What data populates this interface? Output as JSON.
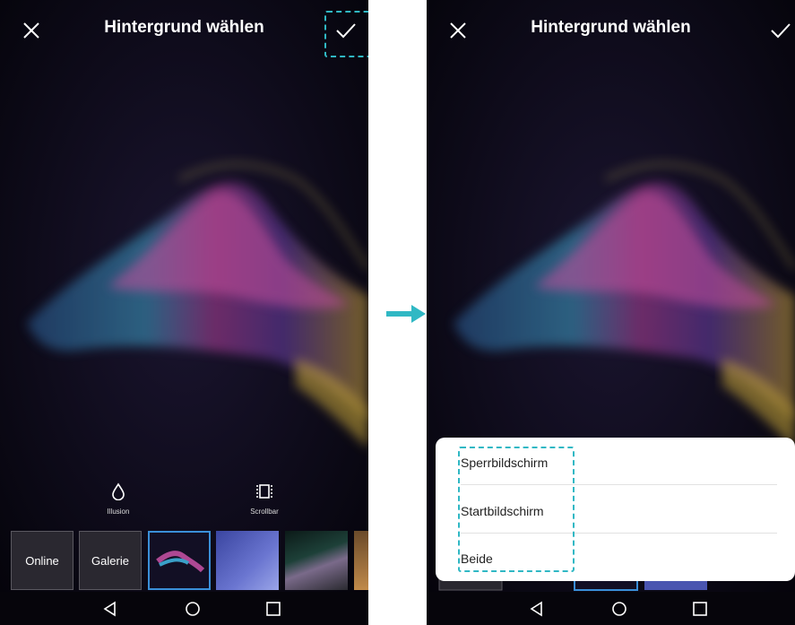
{
  "left_screen": {
    "title": "Hintergrund wählen",
    "close_icon": "close-icon",
    "confirm_icon": "check-icon",
    "tools": [
      {
        "label": "Illusion",
        "icon": "drop-icon"
      },
      {
        "label": "Scrollbar",
        "icon": "scroll-frame-icon"
      }
    ],
    "thumbnails": [
      {
        "label": "Online"
      },
      {
        "label": "Galerie"
      }
    ],
    "nav": [
      "back-icon",
      "home-icon",
      "recents-icon"
    ]
  },
  "right_screen": {
    "title": "Hintergrund wählen",
    "options": [
      "Sperrbildschirm",
      "Startbildschirm",
      "Beide"
    ]
  },
  "colors": {
    "highlight": "#30b8c4",
    "arrow": "#30b8c4",
    "selected_border": "#3a8fd8"
  }
}
